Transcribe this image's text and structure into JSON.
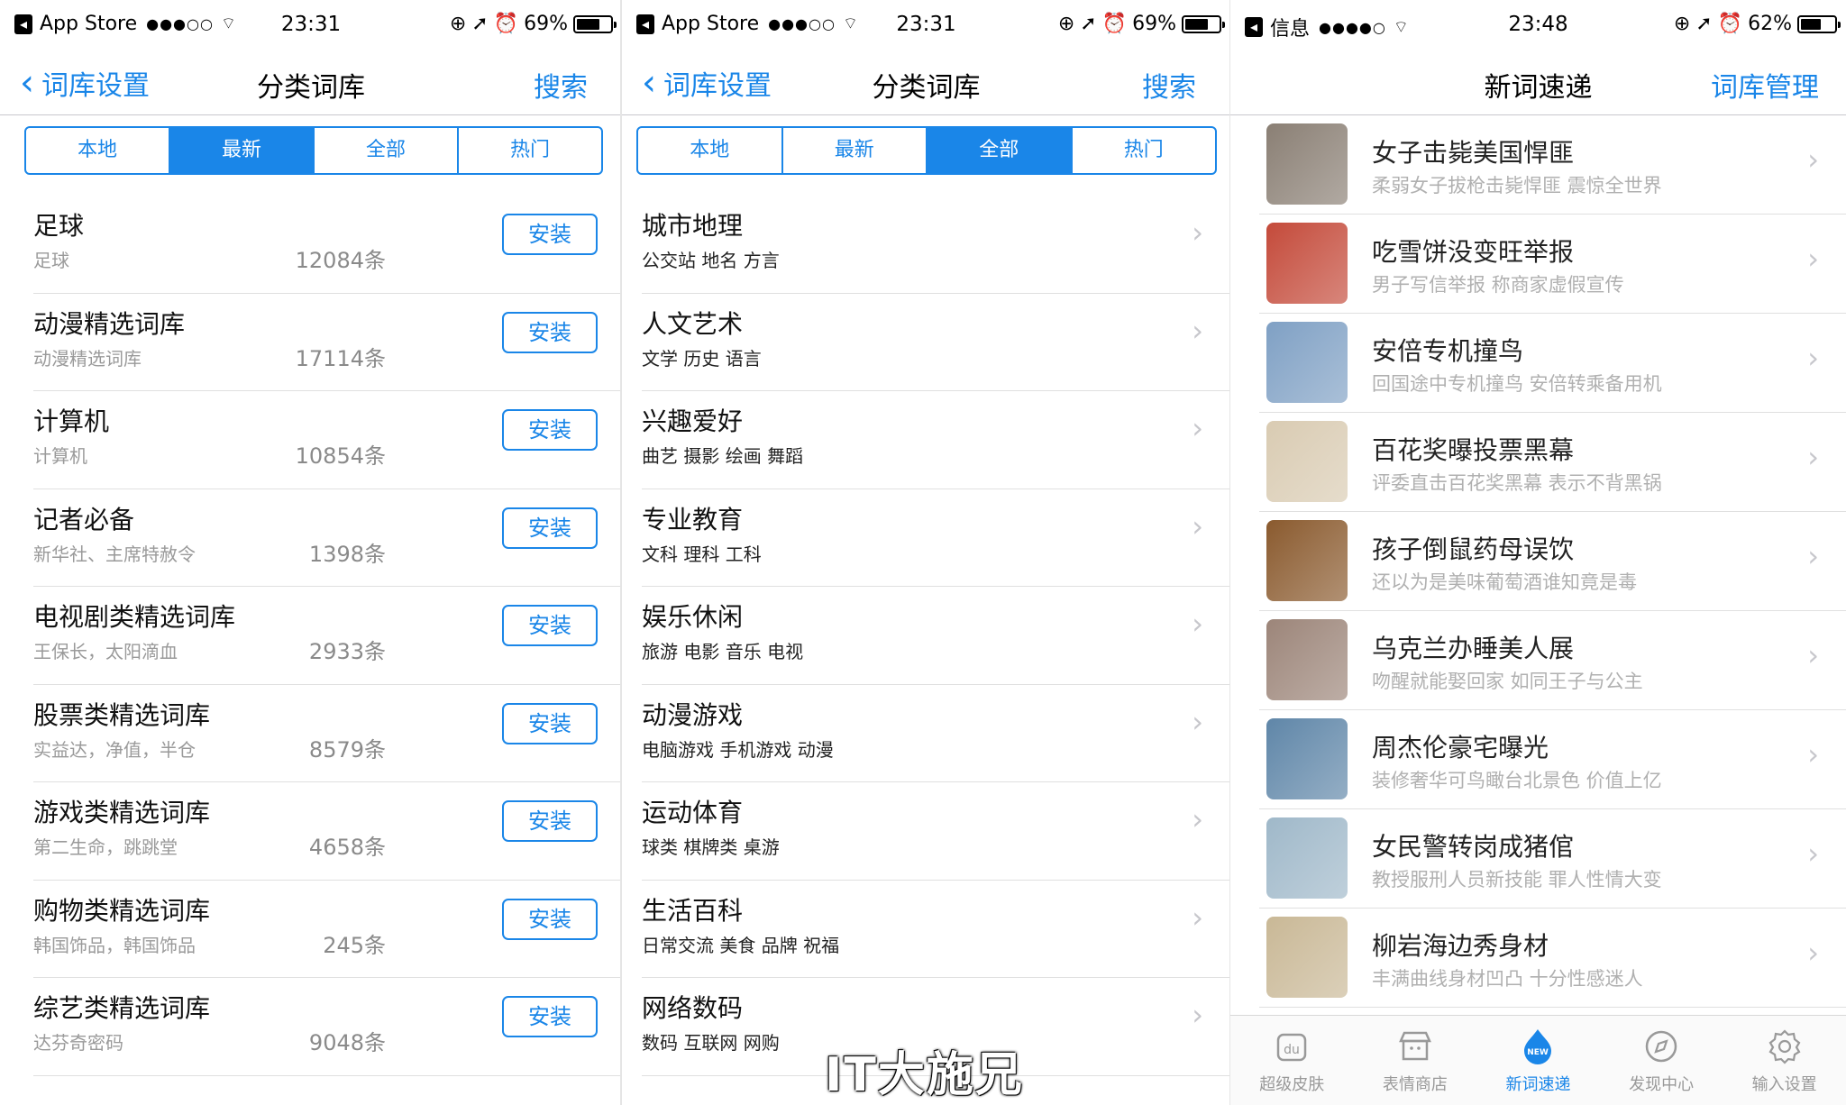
{
  "panel1": {
    "status": {
      "app": "App Store",
      "signal": "●●●○○",
      "time": "23:31",
      "battery": "69%",
      "battery_level": 0.69
    },
    "nav": {
      "back": "词库设置",
      "title": "分类词库",
      "action": "搜索"
    },
    "segments": [
      "本地",
      "最新",
      "全部",
      "热门"
    ],
    "active_segment": 1,
    "install_label": "安装",
    "items": [
      {
        "name": "足球",
        "sub": "足球",
        "count": "12084条"
      },
      {
        "name": "动漫精选词库",
        "sub": "动漫精选词库",
        "count": "17114条"
      },
      {
        "name": "计算机",
        "sub": "计算机",
        "count": "10854条"
      },
      {
        "name": "记者必备",
        "sub": "新华社、主席特赦令",
        "count": "1398条"
      },
      {
        "name": "电视剧类精选词库",
        "sub": "王保长，太阳滴血",
        "count": "2933条"
      },
      {
        "name": "股票类精选词库",
        "sub": "实益达，净值，半仓",
        "count": "8579条"
      },
      {
        "name": "游戏类精选词库",
        "sub": "第二生命，跳跳堂",
        "count": "4658条"
      },
      {
        "name": "购物类精选词库",
        "sub": "韩国饰品，韩国饰品",
        "count": "245条"
      },
      {
        "name": "综艺类精选词库",
        "sub": "达芬奇密码",
        "count": "9048条"
      }
    ]
  },
  "panel2": {
    "status": {
      "app": "App Store",
      "signal": "●●●○○",
      "time": "23:31",
      "battery": "69%",
      "battery_level": 0.69
    },
    "nav": {
      "back": "词库设置",
      "title": "分类词库",
      "action": "搜索"
    },
    "segments": [
      "本地",
      "最新",
      "全部",
      "热门"
    ],
    "active_segment": 2,
    "items": [
      {
        "name": "城市地理",
        "sub": "公交站 地名 方言"
      },
      {
        "name": "人文艺术",
        "sub": "文学 历史 语言"
      },
      {
        "name": "兴趣爱好",
        "sub": "曲艺 摄影 绘画 舞蹈"
      },
      {
        "name": "专业教育",
        "sub": "文科 理科 工科"
      },
      {
        "name": "娱乐休闲",
        "sub": "旅游 电影 音乐 电视"
      },
      {
        "name": "动漫游戏",
        "sub": "电脑游戏 手机游戏 动漫"
      },
      {
        "name": "运动体育",
        "sub": "球类 棋牌类 桌游"
      },
      {
        "name": "生活百科",
        "sub": "日常交流 美食 品牌 祝福"
      },
      {
        "name": "网络数码",
        "sub": "数码 互联网 网购"
      }
    ]
  },
  "panel3": {
    "status": {
      "app": "信息",
      "signal": "●●●●○",
      "time": "23:48",
      "battery": "62%",
      "battery_level": 0.62
    },
    "nav": {
      "title": "新词速递",
      "action": "词库管理"
    },
    "items": [
      {
        "name": "女子击毙美国悍匪",
        "sub": "柔弱女子拔枪击毙悍匪 震惊全世界",
        "thumb": "#8a7f74"
      },
      {
        "name": "吃雪饼没变旺举报",
        "sub": "男子写信举报 称商家虚假宣传",
        "thumb": "#c44a3a"
      },
      {
        "name": "安倍专机撞鸟",
        "sub": "回国途中专机撞鸟 安倍转乘备用机",
        "thumb": "#7fa0c4"
      },
      {
        "name": "百花奖曝投票黑幕",
        "sub": "评委直击百花奖黑幕 表示不背黑锅",
        "thumb": "#d9cbb2"
      },
      {
        "name": "孩子倒鼠药母误饮",
        "sub": "还以为是美味葡萄酒谁知竟是毒",
        "thumb": "#8a5a2e"
      },
      {
        "name": "乌克兰办睡美人展",
        "sub": "吻醒就能娶回家 如同王子与公主",
        "thumb": "#9c8579"
      },
      {
        "name": "周杰伦豪宅曝光",
        "sub": "装修奢华可鸟瞰台北景色 价值上亿",
        "thumb": "#5f86a8"
      },
      {
        "name": "女民警转岗成猪倌",
        "sub": "教授服刑人员新技能 罪人性情大变",
        "thumb": "#9fb8c9"
      },
      {
        "name": "柳岩海边秀身材",
        "sub": "丰满曲线身材凹凸 十分性感迷人",
        "thumb": "#c9b896"
      }
    ],
    "tabs": [
      {
        "label": "超级皮肤",
        "icon": "skin-icon"
      },
      {
        "label": "表情商店",
        "icon": "store-icon"
      },
      {
        "label": "新词速递",
        "icon": "new-icon",
        "badge": "NEW"
      },
      {
        "label": "发现中心",
        "icon": "compass-icon"
      },
      {
        "label": "输入设置",
        "icon": "settings-icon"
      }
    ],
    "active_tab": 2
  },
  "watermark": "IT大施兄",
  "colors": {
    "accent": "#1a86e8",
    "separator": "#e0e0e0",
    "muted": "#9a9a9a"
  }
}
